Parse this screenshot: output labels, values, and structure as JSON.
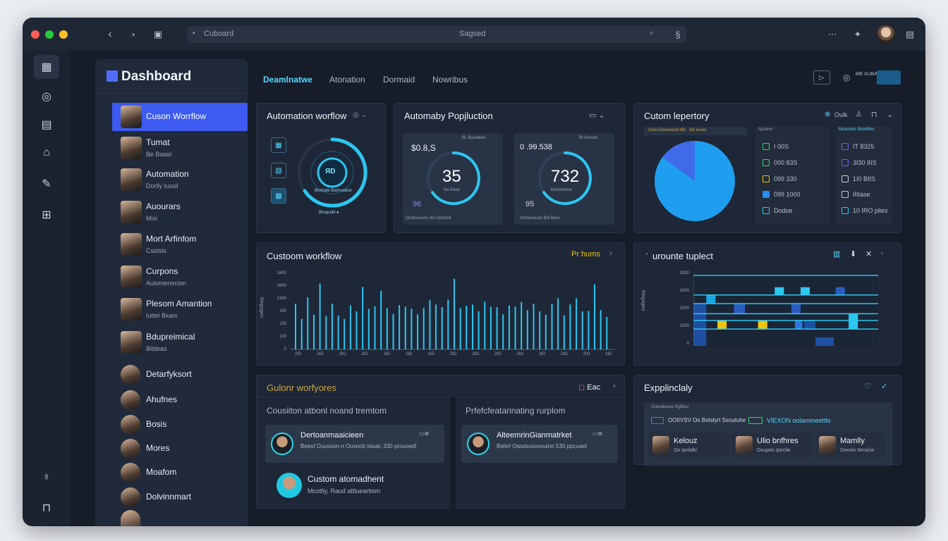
{
  "titlebar": {
    "tab_label": "Cuboard",
    "address": "Sagsed"
  },
  "sidebar": {
    "title": "Dashboard",
    "items": [
      {
        "name": "Cuson Worrflow",
        "sub": ""
      },
      {
        "name": "Tumat",
        "sub": "Be Basel"
      },
      {
        "name": "Automation",
        "sub": "Dorlly lussil"
      },
      {
        "name": "Auourars",
        "sub": "Misi"
      },
      {
        "name": "Mort Arfinfom",
        "sub": "Csidsis"
      },
      {
        "name": "Curpons",
        "sub": "Aulomenocion"
      },
      {
        "name": "Plesom Amantion",
        "sub": "Iuttel Biues"
      },
      {
        "name": "Bdupreimical",
        "sub": "Bildeas"
      },
      {
        "name": "Detarfyksort",
        "sub": ""
      },
      {
        "name": "Ahufnes",
        "sub": ""
      },
      {
        "name": "Bosis",
        "sub": ""
      },
      {
        "name": "Mores",
        "sub": ""
      },
      {
        "name": "Moafom",
        "sub": ""
      },
      {
        "name": "Dolvinnmart",
        "sub": ""
      }
    ]
  },
  "topnav": {
    "tabs": [
      "Deamlnatwe",
      "Atonation",
      "Dormaid",
      "Nowribus"
    ],
    "badge": "ME AUBA"
  },
  "cards": {
    "automation_workflow": {
      "title": "Automation worflow",
      "gauge_label": "ЯD",
      "gauge_caption": "Blomabl Barmodeor",
      "footer": "Bluopabl ●"
    },
    "population": {
      "title": "Automaby Popjluction",
      "left": {
        "value": "35",
        "caption": "Ike Deat",
        "top_text": "$0.8,S",
        "bottom_num": "96",
        "badge": "Bl. Buuallion",
        "footer": "Orsbuxuuno  Iiis  Dorsiisk"
      },
      "right": {
        "value": "732",
        "caption": "Dbumnmor",
        "top_text": "0 .99.538",
        "bottom_num": "95",
        "badge": "Bl.Gecion",
        "footer": "Ostsesuuno  Bol  Boor"
      }
    },
    "custom_lepertory": {
      "title": "Cutom lepertory",
      "head_chip": "Oulk",
      "pie_headers": [
        "Goes Eeeevesd dlis",
        "Ilio euuiu"
      ],
      "col1_header": "Apstlon",
      "col2_header": "Muxcions  Bomilfen",
      "col1": [
        "I 00S",
        "000 83S",
        "099 330",
        "099 1000",
        "Dodoe"
      ],
      "col2": [
        "IT 8325",
        "3I30 IIIS",
        "1I0 BIIS",
        "IIIIase",
        "10 IRO plies"
      ],
      "pie_values": [
        85,
        15
      ]
    },
    "custom_workflow_chart": {
      "title": "Custoom workflow",
      "action": "Pr hums",
      "y_ticks": [
        "1800",
        "1800",
        "1300",
        "180",
        "130",
        "100",
        "0"
      ],
      "y_label": "Ihogugeu",
      "x_ticks": [
        "2ID",
        "2ID",
        "2IO",
        "2IO",
        "2ID",
        "2ID",
        "2ID",
        "2ID",
        "2IO",
        "2IO",
        "2IO",
        "2ID",
        "2IO",
        "2IO",
        "2ID"
      ]
    },
    "uurounte": {
      "title": "urounte tuplect",
      "y_ticks": [
        "1800",
        "1800",
        "1300",
        "1300",
        "0"
      ],
      "y_label": "Ihogugeu"
    },
    "workflows": {
      "title": "Gulonr worfyores",
      "action": "Eac",
      "left_sub": "Cousiiton atbonl noand  tremtom",
      "right_sub": "Prfefcfeatarinating rurplom",
      "rows": [
        {
          "title": "Dertoanmaaicieen",
          "sub": "Beesf Ouusoon n Ousnob isiuat, 330 prouoedl"
        },
        {
          "title": "AlteemrinGianmatrket",
          "sub": "Belief Oasdsusosnuinn 530 ppcuaet"
        },
        {
          "title": "Custom atomadhent",
          "sub": "Mcotliy, Raud attlueartiom"
        }
      ]
    },
    "expplinclaly": {
      "title": "Expplinclaly",
      "sub_head": "Ouuoduuoa   Sigtifuu",
      "chip1": "OOIIVSV Oo Bolstyrl Ssoutuhe",
      "chip2": "VIEXON oolammeettlo",
      "people": [
        {
          "name": "Kelouz",
          "sub": "Oo Ipsitdlv"
        },
        {
          "name": "Ulio bnfhres",
          "sub": "Ooupon Ipeclia"
        },
        {
          "name": "Mamlly",
          "sub": "Ooesin Itersicio"
        }
      ]
    }
  },
  "chart_data": [
    {
      "type": "bar",
      "title": "Custoom workflow",
      "ylabel": "Ihogugeu",
      "ylim": [
        0,
        1800
      ],
      "values": [
        1080,
        720,
        1230,
        820,
        1560,
        790,
        1080,
        800,
        720,
        1040,
        900,
        1480,
        960,
        1020,
        1390,
        980,
        840,
        1050,
        1010,
        960,
        830,
        980,
        1170,
        1060,
        1000,
        1180,
        1670,
        980,
        1030,
        1060,
        900,
        1130,
        1010,
        1000,
        830,
        1040,
        1010,
        1120,
        930,
        1080,
        900,
        820,
        1070,
        1210,
        810,
        1060,
        1210,
        900,
        910,
        1540,
        930,
        770
      ]
    },
    {
      "type": "bar",
      "title": "urounte tuplect",
      "ylabel": "Ihogugeu",
      "ylim": [
        0,
        1800
      ],
      "gridlines": [
        1800,
        1300,
        1080,
        820,
        650,
        430
      ],
      "bars": [
        {
          "x": 0.0,
          "w": 0.07,
          "y0": 0,
          "y1": 1080,
          "color": "#1e4fa0"
        },
        {
          "x": 0.07,
          "w": 0.05,
          "y0": 1080,
          "y1": 1300,
          "color": "#1aa6e0"
        },
        {
          "x": 0.13,
          "w": 0.05,
          "y0": 430,
          "y1": 650,
          "color": "#f1c40f"
        },
        {
          "x": 0.22,
          "w": 0.06,
          "y0": 820,
          "y1": 1080,
          "color": "#2b5cc0"
        },
        {
          "x": 0.35,
          "w": 0.05,
          "y0": 430,
          "y1": 650,
          "color": "#f1c40f"
        },
        {
          "x": 0.44,
          "w": 0.05,
          "y0": 1300,
          "y1": 1500,
          "color": "#2cc6f0"
        },
        {
          "x": 0.53,
          "w": 0.05,
          "y0": 820,
          "y1": 1080,
          "color": "#2b5cc0"
        },
        {
          "x": 0.58,
          "w": 0.05,
          "y0": 1300,
          "y1": 1500,
          "color": "#2cc6f0"
        },
        {
          "x": 0.55,
          "w": 0.04,
          "y0": 430,
          "y1": 650,
          "color": "#2b78e0"
        },
        {
          "x": 0.6,
          "w": 0.06,
          "y0": 430,
          "y1": 650,
          "color": "#1e4fa0"
        },
        {
          "x": 0.66,
          "w": 0.1,
          "y0": 0,
          "y1": 220,
          "color": "#1e4fa0"
        },
        {
          "x": 0.77,
          "w": 0.05,
          "y0": 1300,
          "y1": 1500,
          "color": "#2b5cc0"
        },
        {
          "x": 0.84,
          "w": 0.05,
          "y0": 430,
          "y1": 820,
          "color": "#2cc6f0"
        }
      ]
    }
  ]
}
